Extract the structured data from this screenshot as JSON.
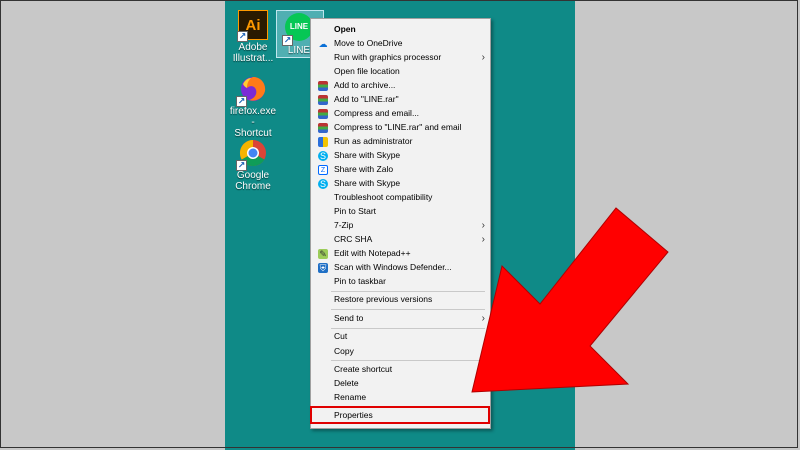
{
  "desktop": {
    "icons": [
      {
        "label_line1": "Adobe",
        "label_line2": "Illustrat...",
        "glyph": "Ai",
        "icon": "illustrator-icon"
      },
      {
        "label_line1": "LINE",
        "label_line2": "",
        "glyph": "LINE",
        "icon": "line-app-icon"
      },
      {
        "label_line1": "firefox.exe -",
        "label_line2": "Shortcut",
        "icon": "firefox-icon"
      },
      {
        "label_line1": "Google",
        "label_line2": "Chrome",
        "icon": "chrome-icon"
      }
    ]
  },
  "context_menu": {
    "items": [
      {
        "label": "Open",
        "bold": true
      },
      {
        "label": "Move to OneDrive",
        "icon": "onedrive-icon"
      },
      {
        "label": "Run with graphics processor",
        "submenu": true
      },
      {
        "label": "Open file location"
      },
      {
        "label": "Add to archive...",
        "icon": "winrar-icon"
      },
      {
        "label": "Add to \"LINE.rar\"",
        "icon": "winrar-icon"
      },
      {
        "label": "Compress and email...",
        "icon": "winrar-icon"
      },
      {
        "label": "Compress to \"LINE.rar\" and email",
        "icon": "winrar-icon"
      },
      {
        "label": "Run as administrator",
        "icon": "uac-shield-icon"
      },
      {
        "label": "Share with Skype",
        "icon": "skype-icon"
      },
      {
        "label": "Share with Zalo",
        "icon": "zalo-icon"
      },
      {
        "label": "Share with Skype",
        "icon": "skype-icon"
      },
      {
        "label": "Troubleshoot compatibility"
      },
      {
        "label": "Pin to Start"
      },
      {
        "label": "7-Zip",
        "submenu": true
      },
      {
        "label": "CRC SHA",
        "submenu": true
      },
      {
        "label": "Edit with Notepad++",
        "icon": "notepadpp-icon"
      },
      {
        "label": "Scan with Windows Defender...",
        "icon": "defender-icon"
      },
      {
        "label": "Pin to taskbar"
      },
      {
        "label": "Restore previous versions"
      },
      {
        "label": "Send to",
        "submenu": true
      },
      {
        "label": "Cut"
      },
      {
        "label": "Copy"
      },
      {
        "label": "Create shortcut"
      },
      {
        "label": "Delete"
      },
      {
        "label": "Rename"
      },
      {
        "label": "Properties",
        "highlighted": true
      }
    ]
  },
  "colors": {
    "desktop_bg": "#0f8a87",
    "highlight_box": "#e00000",
    "arrow": "#ff0000"
  }
}
